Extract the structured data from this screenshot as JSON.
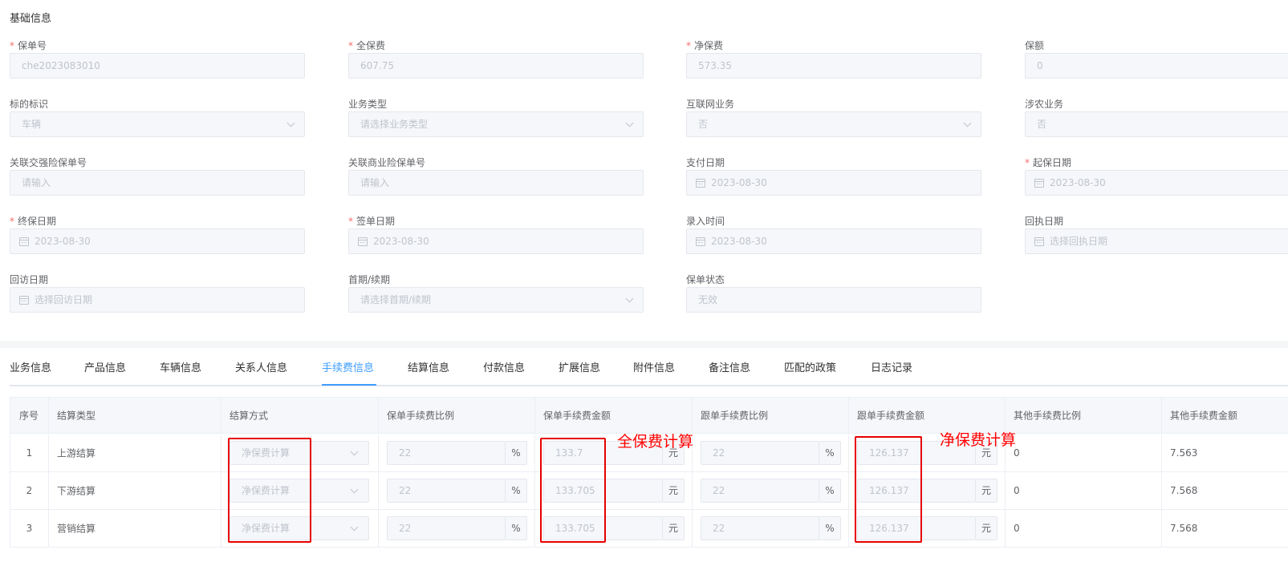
{
  "section_title": "基础信息",
  "form": {
    "policy_no": {
      "label": "保单号",
      "required": true,
      "value": "che2023083010"
    },
    "full_premium": {
      "label": "全保费",
      "required": true,
      "value": "607.75"
    },
    "net_premium": {
      "label": "净保费",
      "required": true,
      "value": "573.35"
    },
    "insured_amount": {
      "label": "保额",
      "required": false,
      "value": "0"
    },
    "subject_mark": {
      "label": "标的标识",
      "required": false,
      "value": "车辆"
    },
    "business_type": {
      "label": "业务类型",
      "required": false,
      "placeholder": "请选择业务类型"
    },
    "internet_business": {
      "label": "互联网业务",
      "required": false,
      "value": "否"
    },
    "agri_business": {
      "label": "涉农业务",
      "required": false,
      "value": "否"
    },
    "related_compulsory_no": {
      "label": "关联交强险保单号",
      "required": false,
      "placeholder": "请输入"
    },
    "related_commercial_no": {
      "label": "关联商业险保单号",
      "required": false,
      "placeholder": "请输入"
    },
    "payment_date": {
      "label": "支付日期",
      "required": false,
      "value": "2023-08-30"
    },
    "start_date": {
      "label": "起保日期",
      "required": true,
      "value": "2023-08-30"
    },
    "end_date": {
      "label": "终保日期",
      "required": true,
      "value": "2023-08-30"
    },
    "sign_date": {
      "label": "签单日期",
      "required": true,
      "value": "2023-08-30"
    },
    "entry_time": {
      "label": "录入时间",
      "required": false,
      "value": "2023-08-30"
    },
    "receipt_date": {
      "label": "回执日期",
      "required": false,
      "placeholder": "选择回执日期"
    },
    "revisit_date": {
      "label": "回访日期",
      "required": false,
      "placeholder": "选择回访日期"
    },
    "first_renewal": {
      "label": "首期/续期",
      "required": false,
      "placeholder": "请选择首期/续期"
    },
    "policy_status": {
      "label": "保单状态",
      "required": false,
      "value": "无效"
    }
  },
  "tabs": [
    "业务信息",
    "产品信息",
    "车辆信息",
    "关系人信息",
    "手续费信息",
    "结算信息",
    "付款信息",
    "扩展信息",
    "附件信息",
    "备注信息",
    "匹配的政策",
    "日志记录"
  ],
  "active_tab": "手续费信息",
  "table": {
    "headers": [
      "序号",
      "结算类型",
      "结算方式",
      "保单手续费比例",
      "保单手续费金额",
      "跟单手续费比例",
      "跟单手续费金额",
      "其他手续费比例",
      "其他手续费金额"
    ],
    "percent_unit": "%",
    "currency_unit": "元",
    "rows": [
      {
        "no": "1",
        "type": "上游结算",
        "method": "净保费计算",
        "policy_ratio": "22",
        "policy_amount": "133.7",
        "doc_ratio": "22",
        "doc_amount": "126.137",
        "other_ratio": "0",
        "other_amount": "7.563"
      },
      {
        "no": "2",
        "type": "下游结算",
        "method": "净保费计算",
        "policy_ratio": "22",
        "policy_amount": "133.705",
        "doc_ratio": "22",
        "doc_amount": "126.137",
        "other_ratio": "0",
        "other_amount": "7.568"
      },
      {
        "no": "3",
        "type": "营销结算",
        "method": "净保费计算",
        "policy_ratio": "22",
        "policy_amount": "133.705",
        "doc_ratio": "22",
        "doc_amount": "126.137",
        "other_ratio": "0",
        "other_amount": "7.568"
      }
    ]
  },
  "annotations": {
    "full_premium_note": "全保费计算",
    "net_premium_note": "净保费计算"
  },
  "colors": {
    "accent": "#409eff",
    "required": "#f56c6c",
    "annotation": "#ff0000"
  }
}
